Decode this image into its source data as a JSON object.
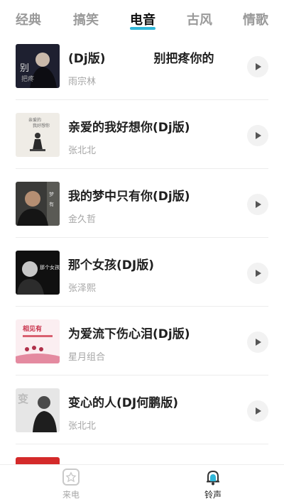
{
  "tabs": [
    {
      "label": "经典",
      "active": false
    },
    {
      "label": "搞笑",
      "active": false
    },
    {
      "label": "电音",
      "active": true
    },
    {
      "label": "古风",
      "active": false
    },
    {
      "label": "情歌",
      "active": false
    }
  ],
  "songs": [
    {
      "title": "(Dj版)　　　　别把疼你的",
      "artist": "雨宗林"
    },
    {
      "title": "亲爱的我好想你(Dj版)",
      "artist": "张北北"
    },
    {
      "title": "我的梦中只有你(Dj版)",
      "artist": "金久哲"
    },
    {
      "title": "那个女孩(DJ版)",
      "artist": "张泽熙"
    },
    {
      "title": "为爱流下伤心泪(Dj版)",
      "artist": "星月组合"
    },
    {
      "title": "变心的人(DJ何鹏版)",
      "artist": "张北北"
    }
  ],
  "bottom_nav": [
    {
      "label": "来电",
      "active": false,
      "icon": "phone-ring-icon"
    },
    {
      "label": "铃声",
      "active": true,
      "icon": "bell-icon"
    }
  ],
  "colors": {
    "accent": "#2fb6d8",
    "inactive": "#9a9a9a"
  }
}
